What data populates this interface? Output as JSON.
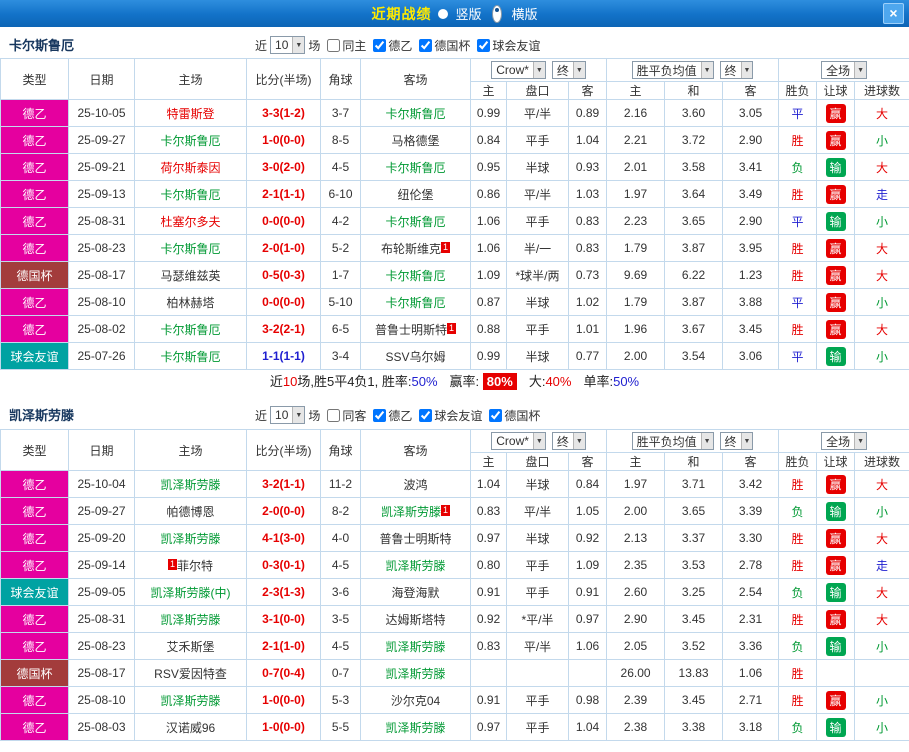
{
  "titlebar": {
    "title": "近期战绩",
    "vertical": "竖版",
    "horizontal": "横版",
    "close": "×"
  },
  "sections": [
    {
      "team": "卡尔斯鲁厄",
      "filter": {
        "near": "近",
        "count": "10",
        "games": "场",
        "same": "同主",
        "league1": "德乙",
        "league2": "德国杯",
        "league3": "球会友谊"
      },
      "dropdowns": {
        "book": "Crow*",
        "fin1": "终",
        "avg": "胜平负均值",
        "fin2": "终",
        "scope": "全场"
      },
      "headers": {
        "type": "类型",
        "date": "日期",
        "home": "主场",
        "score": "比分(半场)",
        "corner": "角球",
        "away": "客场",
        "h1": "主",
        "hcap": "盘口",
        "a1": "客",
        "h2": "主",
        "d": "和",
        "a2": "客",
        "wl": "胜负",
        "hd": "让球",
        "goals": "进球数"
      },
      "rows": [
        {
          "lg": "德乙",
          "lgk": "de2",
          "date": "25-10-05",
          "hpre": "",
          "home": "特雷斯登",
          "homek": "red",
          "hsup": "",
          "score": "3-3(1-2)",
          "scorek": "red",
          "corner": "3-7",
          "apre": "",
          "away": "卡尔斯鲁厄",
          "awayk": "green",
          "asup": "",
          "o1": "0.99",
          "hc": "平/半",
          "o2": "0.89",
          "a1": "2.16",
          "a2": "3.60",
          "a3": "3.05",
          "wl": "平",
          "wlk": "blue",
          "hd": "赢",
          "hdk": "red",
          "gl": "大",
          "glk": "red"
        },
        {
          "lg": "德乙",
          "lgk": "de2",
          "date": "25-09-27",
          "hpre": "",
          "home": "卡尔斯鲁厄",
          "homek": "green",
          "hsup": "",
          "score": "1-0(0-0)",
          "scorek": "red",
          "corner": "8-5",
          "apre": "",
          "away": "马格德堡",
          "awayk": "black",
          "asup": "",
          "o1": "0.84",
          "hc": "平手",
          "o2": "1.04",
          "a1": "2.21",
          "a2": "3.72",
          "a3": "2.90",
          "wl": "胜",
          "wlk": "red",
          "hd": "赢",
          "hdk": "red",
          "gl": "小",
          "glk": "green"
        },
        {
          "lg": "德乙",
          "lgk": "de2",
          "date": "25-09-21",
          "hpre": "",
          "home": "荷尔斯泰因",
          "homek": "red",
          "hsup": "",
          "score": "3-0(2-0)",
          "scorek": "red",
          "corner": "4-5",
          "apre": "",
          "away": "卡尔斯鲁厄",
          "awayk": "green",
          "asup": "",
          "o1": "0.95",
          "hc": "半球",
          "o2": "0.93",
          "a1": "2.01",
          "a2": "3.58",
          "a3": "3.41",
          "wl": "负",
          "wlk": "green",
          "hd": "输",
          "hdk": "green",
          "gl": "大",
          "glk": "red"
        },
        {
          "lg": "德乙",
          "lgk": "de2",
          "date": "25-09-13",
          "hpre": "",
          "home": "卡尔斯鲁厄",
          "homek": "green",
          "hsup": "",
          "score": "2-1(1-1)",
          "scorek": "red",
          "corner": "6-10",
          "apre": "",
          "away": "纽伦堡",
          "awayk": "black",
          "asup": "",
          "o1": "0.86",
          "hc": "平/半",
          "o2": "1.03",
          "a1": "1.97",
          "a2": "3.64",
          "a3": "3.49",
          "wl": "胜",
          "wlk": "red",
          "hd": "赢",
          "hdk": "red",
          "gl": "走",
          "glk": "blue"
        },
        {
          "lg": "德乙",
          "lgk": "de2",
          "date": "25-08-31",
          "hpre": "",
          "home": "杜塞尔多夫",
          "homek": "red",
          "hsup": "",
          "score": "0-0(0-0)",
          "scorek": "red",
          "corner": "4-2",
          "apre": "",
          "away": "卡尔斯鲁厄",
          "awayk": "green",
          "asup": "",
          "o1": "1.06",
          "hc": "平手",
          "o2": "0.83",
          "a1": "2.23",
          "a2": "3.65",
          "a3": "2.90",
          "wl": "平",
          "wlk": "blue",
          "hd": "输",
          "hdk": "green",
          "gl": "小",
          "glk": "green"
        },
        {
          "lg": "德乙",
          "lgk": "de2",
          "date": "25-08-23",
          "hpre": "",
          "home": "卡尔斯鲁厄",
          "homek": "green",
          "hsup": "",
          "score": "2-0(1-0)",
          "scorek": "red",
          "corner": "5-2",
          "apre": "",
          "away": "布轮斯维克",
          "awayk": "black",
          "asup": "1",
          "o1": "1.06",
          "hc": "半/一",
          "o2": "0.83",
          "a1": "1.79",
          "a2": "3.87",
          "a3": "3.95",
          "wl": "胜",
          "wlk": "red",
          "hd": "赢",
          "hdk": "red",
          "gl": "大",
          "glk": "red"
        },
        {
          "lg": "德国杯",
          "lgk": "cup",
          "date": "25-08-17",
          "hpre": "",
          "home": "马瑟维兹英",
          "homek": "black",
          "hsup": "",
          "score": "0-5(0-3)",
          "scorek": "red",
          "corner": "1-7",
          "apre": "",
          "away": "卡尔斯鲁厄",
          "awayk": "green",
          "asup": "",
          "o1": "1.09",
          "hc": "*球半/两",
          "o2": "0.73",
          "a1": "9.69",
          "a2": "6.22",
          "a3": "1.23",
          "wl": "胜",
          "wlk": "red",
          "hd": "赢",
          "hdk": "red",
          "gl": "大",
          "glk": "red"
        },
        {
          "lg": "德乙",
          "lgk": "de2",
          "date": "25-08-10",
          "hpre": "",
          "home": "柏林赫塔",
          "homek": "black",
          "hsup": "",
          "score": "0-0(0-0)",
          "scorek": "red",
          "corner": "5-10",
          "apre": "",
          "away": "卡尔斯鲁厄",
          "awayk": "green",
          "asup": "",
          "o1": "0.87",
          "hc": "半球",
          "o2": "1.02",
          "a1": "1.79",
          "a2": "3.87",
          "a3": "3.88",
          "wl": "平",
          "wlk": "blue",
          "hd": "赢",
          "hdk": "red",
          "gl": "小",
          "glk": "green"
        },
        {
          "lg": "德乙",
          "lgk": "de2",
          "date": "25-08-02",
          "hpre": "",
          "home": "卡尔斯鲁厄",
          "homek": "green",
          "hsup": "",
          "score": "3-2(2-1)",
          "scorek": "red",
          "corner": "6-5",
          "apre": "",
          "away": "普鲁士明斯特",
          "awayk": "black",
          "asup": "1",
          "o1": "0.88",
          "hc": "平手",
          "o2": "1.01",
          "a1": "1.96",
          "a2": "3.67",
          "a3": "3.45",
          "wl": "胜",
          "wlk": "red",
          "hd": "赢",
          "hdk": "red",
          "gl": "大",
          "glk": "red"
        },
        {
          "lg": "球会友谊",
          "lgk": "friendly",
          "date": "25-07-26",
          "hpre": "",
          "home": "卡尔斯鲁厄",
          "homek": "green",
          "hsup": "",
          "score": "1-1(1-1)",
          "scorek": "blue",
          "corner": "3-4",
          "apre": "",
          "away": "SSV乌尔姆",
          "awayk": "black",
          "asup": "",
          "o1": "0.99",
          "hc": "半球",
          "o2": "0.77",
          "a1": "2.00",
          "a2": "3.54",
          "a3": "3.06",
          "wl": "平",
          "wlk": "blue",
          "hd": "输",
          "hdk": "green",
          "gl": "小",
          "glk": "green"
        }
      ],
      "summary": {
        "t1": "近",
        "n1": "10",
        "t2": "场,胜5平4负1, 胜率:",
        "n2": "50%",
        "t3": "赢率:",
        "n3": "80%",
        "t4": "大:",
        "n4": "40%",
        "t5": "单率:",
        "n5": "50%"
      }
    },
    {
      "team": "凯泽斯劳滕",
      "filter": {
        "near": "近",
        "count": "10",
        "games": "场",
        "same": "同客",
        "league1": "德乙",
        "league2": "球会友谊",
        "league3": "德国杯"
      },
      "dropdowns": {
        "book": "Crow*",
        "fin1": "终",
        "avg": "胜平负均值",
        "fin2": "终",
        "scope": "全场"
      },
      "headers": {
        "type": "类型",
        "date": "日期",
        "home": "主场",
        "score": "比分(半场)",
        "corner": "角球",
        "away": "客场",
        "h1": "主",
        "hcap": "盘口",
        "a1": "客",
        "h2": "主",
        "d": "和",
        "a2": "客",
        "wl": "胜负",
        "hd": "让球",
        "goals": "进球数"
      },
      "rows": [
        {
          "lg": "德乙",
          "lgk": "de2",
          "date": "25-10-04",
          "hpre": "",
          "home": "凯泽斯劳滕",
          "homek": "green",
          "hsup": "",
          "score": "3-2(1-1)",
          "scorek": "red",
          "corner": "11-2",
          "apre": "",
          "away": "波鸿",
          "awayk": "black",
          "asup": "",
          "o1": "1.04",
          "hc": "半球",
          "o2": "0.84",
          "a1": "1.97",
          "a2": "3.71",
          "a3": "3.42",
          "wl": "胜",
          "wlk": "red",
          "hd": "赢",
          "hdk": "red",
          "gl": "大",
          "glk": "red"
        },
        {
          "lg": "德乙",
          "lgk": "de2",
          "date": "25-09-27",
          "hpre": "",
          "home": "帕德博恩",
          "homek": "black",
          "hsup": "",
          "score": "2-0(0-0)",
          "scorek": "red",
          "corner": "8-2",
          "apre": "",
          "away": "凯泽斯劳滕",
          "awayk": "green",
          "asup": "1",
          "o1": "0.83",
          "hc": "平/半",
          "o2": "1.05",
          "a1": "2.00",
          "a2": "3.65",
          "a3": "3.39",
          "wl": "负",
          "wlk": "green",
          "hd": "输",
          "hdk": "green",
          "gl": "小",
          "glk": "green"
        },
        {
          "lg": "德乙",
          "lgk": "de2",
          "date": "25-09-20",
          "hpre": "",
          "home": "凯泽斯劳滕",
          "homek": "green",
          "hsup": "",
          "score": "4-1(3-0)",
          "scorek": "red",
          "corner": "4-0",
          "apre": "",
          "away": "普鲁士明斯特",
          "awayk": "black",
          "asup": "",
          "o1": "0.97",
          "hc": "半球",
          "o2": "0.92",
          "a1": "2.13",
          "a2": "3.37",
          "a3": "3.30",
          "wl": "胜",
          "wlk": "red",
          "hd": "赢",
          "hdk": "red",
          "gl": "大",
          "glk": "red"
        },
        {
          "lg": "德乙",
          "lgk": "de2",
          "date": "25-09-14",
          "hpre": "1",
          "home": "菲尔特",
          "homek": "black",
          "hsup": "",
          "score": "0-3(0-1)",
          "scorek": "red",
          "corner": "4-5",
          "apre": "",
          "away": "凯泽斯劳滕",
          "awayk": "green",
          "asup": "",
          "o1": "0.80",
          "hc": "平手",
          "o2": "1.09",
          "a1": "2.35",
          "a2": "3.53",
          "a3": "2.78",
          "wl": "胜",
          "wlk": "red",
          "hd": "赢",
          "hdk": "red",
          "gl": "走",
          "glk": "blue"
        },
        {
          "lg": "球会友谊",
          "lgk": "friendly",
          "date": "25-09-05",
          "hpre": "",
          "home": "凯泽斯劳滕(中)",
          "homek": "green",
          "hsup": "",
          "score": "2-3(1-3)",
          "scorek": "red",
          "corner": "3-6",
          "apre": "",
          "away": "海登海默",
          "awayk": "black",
          "asup": "",
          "o1": "0.91",
          "hc": "平手",
          "o2": "0.91",
          "a1": "2.60",
          "a2": "3.25",
          "a3": "2.54",
          "wl": "负",
          "wlk": "green",
          "hd": "输",
          "hdk": "green",
          "gl": "大",
          "glk": "red"
        },
        {
          "lg": "德乙",
          "lgk": "de2",
          "date": "25-08-31",
          "hpre": "",
          "home": "凯泽斯劳滕",
          "homek": "green",
          "hsup": "",
          "score": "3-1(0-0)",
          "scorek": "red",
          "corner": "3-5",
          "apre": "",
          "away": "达姆斯塔特",
          "awayk": "black",
          "asup": "",
          "o1": "0.92",
          "hc": "*平/半",
          "o2": "0.97",
          "a1": "2.90",
          "a2": "3.45",
          "a3": "2.31",
          "wl": "胜",
          "wlk": "red",
          "hd": "赢",
          "hdk": "red",
          "gl": "大",
          "glk": "red"
        },
        {
          "lg": "德乙",
          "lgk": "de2",
          "date": "25-08-23",
          "hpre": "",
          "home": "艾禾斯堡",
          "homek": "black",
          "hsup": "",
          "score": "2-1(1-0)",
          "scorek": "red",
          "corner": "4-5",
          "apre": "",
          "away": "凯泽斯劳滕",
          "awayk": "green",
          "asup": "",
          "o1": "0.83",
          "hc": "平/半",
          "o2": "1.06",
          "a1": "2.05",
          "a2": "3.52",
          "a3": "3.36",
          "wl": "负",
          "wlk": "green",
          "hd": "输",
          "hdk": "green",
          "gl": "小",
          "glk": "green"
        },
        {
          "lg": "德国杯",
          "lgk": "cup",
          "date": "25-08-17",
          "hpre": "",
          "home": "RSV爱因特查",
          "homek": "black",
          "hsup": "",
          "score": "0-7(0-4)",
          "scorek": "red",
          "corner": "0-7",
          "apre": "",
          "away": "凯泽斯劳滕",
          "awayk": "green",
          "asup": "",
          "o1": "",
          "hc": "",
          "o2": "",
          "a1": "26.00",
          "a2": "13.83",
          "a3": "1.06",
          "wl": "胜",
          "wlk": "red",
          "hd": "",
          "hdk": "",
          "gl": "",
          "glk": ""
        },
        {
          "lg": "德乙",
          "lgk": "de2",
          "date": "25-08-10",
          "hpre": "",
          "home": "凯泽斯劳滕",
          "homek": "green",
          "hsup": "",
          "score": "1-0(0-0)",
          "scorek": "red",
          "corner": "5-3",
          "apre": "",
          "away": "沙尔克04",
          "awayk": "black",
          "asup": "",
          "o1": "0.91",
          "hc": "平手",
          "o2": "0.98",
          "a1": "2.39",
          "a2": "3.45",
          "a3": "2.71",
          "wl": "胜",
          "wlk": "red",
          "hd": "赢",
          "hdk": "red",
          "gl": "小",
          "glk": "green"
        },
        {
          "lg": "德乙",
          "lgk": "de2",
          "date": "25-08-03",
          "hpre": "",
          "home": "汉诺威96",
          "homek": "black",
          "hsup": "",
          "score": "1-0(0-0)",
          "scorek": "red",
          "corner": "5-5",
          "apre": "",
          "away": "凯泽斯劳滕",
          "awayk": "green",
          "asup": "",
          "o1": "0.97",
          "hc": "平手",
          "o2": "1.04",
          "a1": "2.38",
          "a2": "3.38",
          "a3": "3.18",
          "wl": "负",
          "wlk": "green",
          "hd": "输",
          "hdk": "green",
          "gl": "小",
          "glk": "green"
        }
      ]
    }
  ],
  "colors": {
    "accent_blue": "#1272c8",
    "league_de2": "#e5009f",
    "league_cup": "#a33c3c",
    "league_friendly": "#00a2a2",
    "win_red": "#e60000",
    "lose_green": "#00a651",
    "draw_blue": "#1f1fd0",
    "team_green": "#009933"
  }
}
